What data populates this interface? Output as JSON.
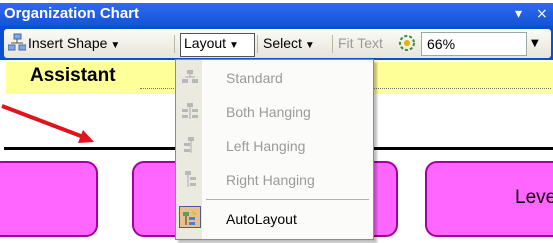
{
  "panel": {
    "title": "Organization Chart",
    "close_glyph": "×",
    "menu_glyph": "▾"
  },
  "toolbar": {
    "insert_shape": "Insert Shape",
    "layout": "Layout",
    "select": "Select",
    "fit_text": "Fit Text",
    "zoom_value": "66%"
  },
  "layout_menu": {
    "items": [
      {
        "label": "Standard",
        "enabled": false,
        "icon": "standard-layout-icon"
      },
      {
        "label": "Both Hanging",
        "enabled": false,
        "icon": "both-hanging-icon"
      },
      {
        "label": "Left Hanging",
        "enabled": false,
        "icon": "left-hanging-icon"
      },
      {
        "label": "Right Hanging",
        "enabled": false,
        "icon": "right-hanging-icon"
      },
      {
        "label": "AutoLayout",
        "enabled": true,
        "checked": true,
        "icon": "autolayout-icon"
      }
    ]
  },
  "chart": {
    "assistant_label": "Assistant",
    "level_label": "Leve"
  },
  "colors": {
    "toolbar_blue": "#0a4fce",
    "node_fill": "#ff66ff",
    "node_border": "#a3009f",
    "assistant_fill": "#ffff99",
    "arrow": "#e0141e"
  }
}
